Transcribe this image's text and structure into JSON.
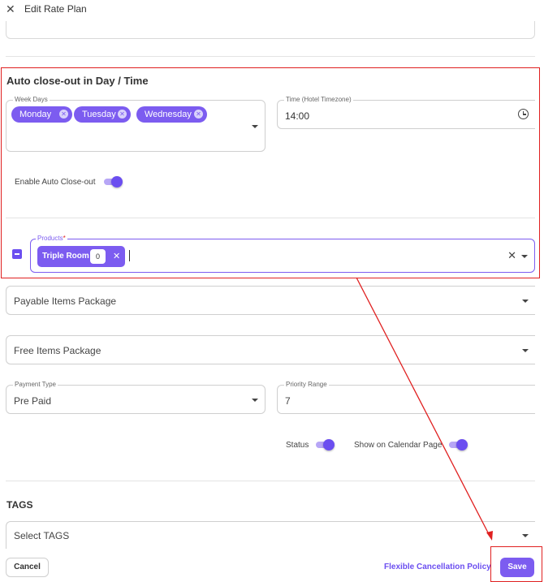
{
  "header": {
    "close_icon": "close-icon",
    "title": "Edit Rate Plan"
  },
  "auto_closeout": {
    "section_title": "Auto close-out in Day / Time",
    "week_days": {
      "label": "Week Days",
      "selected": [
        "Monday",
        "Tuesday",
        "Wednesday"
      ]
    },
    "time": {
      "label": "Time (Hotel Timezone)",
      "value": "14:00",
      "icon": "clock-icon"
    },
    "enable_label": "Enable Auto Close-out",
    "enable_on": true,
    "products": {
      "label": "Products",
      "required_mark": "*",
      "chip_label": "Triple Room",
      "chip_count": "0"
    }
  },
  "payable_items": {
    "label": "Payable Items Package"
  },
  "free_items": {
    "label": "Free Items Package"
  },
  "payment_type": {
    "label": "Payment Type",
    "value": "Pre Paid"
  },
  "priority_range": {
    "label": "Priority Range",
    "value": "7"
  },
  "status": {
    "label": "Status",
    "on": true
  },
  "show_on_calendar": {
    "label": "Show on Calendar Page",
    "on": true
  },
  "tags": {
    "title": "TAGS",
    "placeholder": "Select TAGS"
  },
  "footer": {
    "cancel": "Cancel",
    "policy_link": "Flexible Cancellation Policy",
    "save": "Save"
  },
  "colors": {
    "accent": "#7c5cf0",
    "annotation": "#e02020"
  }
}
